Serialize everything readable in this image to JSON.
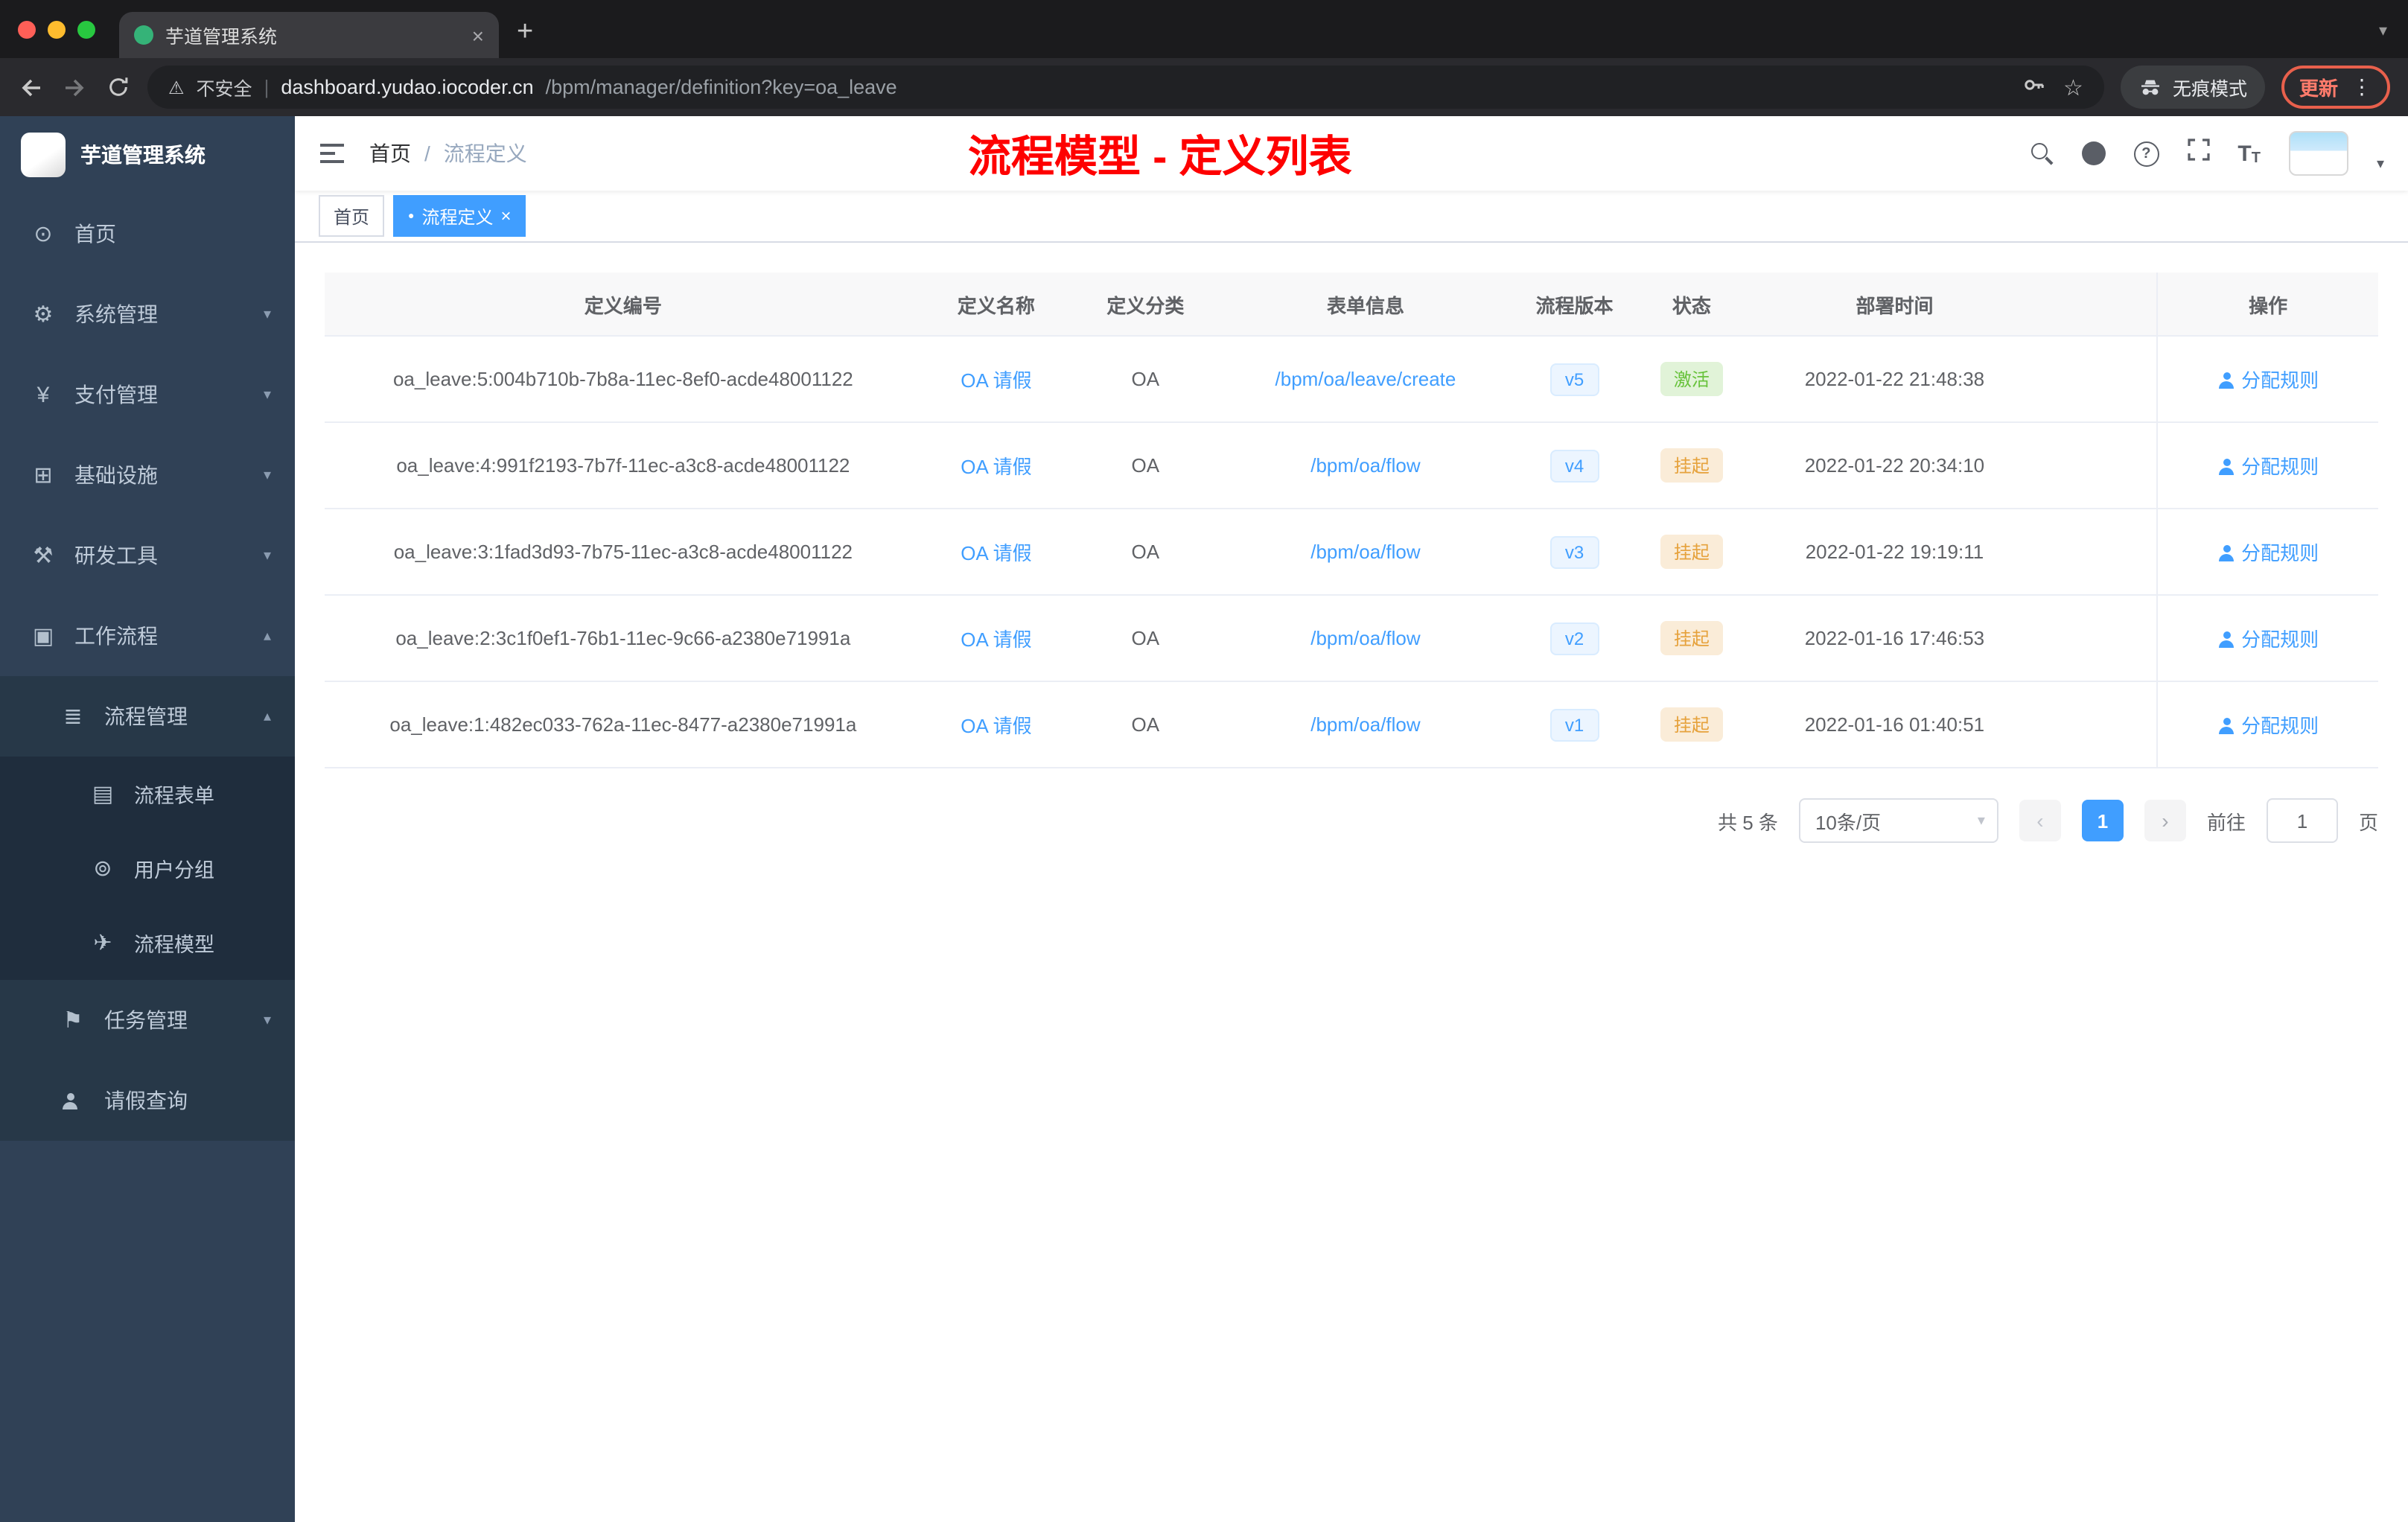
{
  "browser": {
    "tab_title": "芋道管理系统",
    "security": "不安全",
    "url_host": "dashboard.yudao.iocoder.cn",
    "url_rest": "/bpm/manager/definition?key=oa_leave",
    "incognito": "无痕模式",
    "update": "更新"
  },
  "icons": {
    "dashboard": "⊙",
    "gear": "⚙",
    "yen": "¥",
    "infra": "⊞",
    "tools": "⚒",
    "workflow": "▣",
    "list": "≣",
    "form": "▤",
    "group": "⊚",
    "send": "✈",
    "task": "⚑",
    "chevron_down": "▾",
    "chevron_up": "▴",
    "chevron_left": "‹",
    "chevron_right": "›",
    "close": "×",
    "dot": "●",
    "kebab": "⋮",
    "star": "☆",
    "warning": "⚠",
    "plus": "+",
    "divider": "|",
    "question": "?",
    "font_size": "T"
  },
  "sidebar": {
    "title": "芋道管理系统",
    "items": [
      {
        "label": "首页"
      },
      {
        "label": "系统管理"
      },
      {
        "label": "支付管理"
      },
      {
        "label": "基础设施"
      },
      {
        "label": "研发工具"
      },
      {
        "label": "工作流程"
      },
      {
        "label": "流程管理"
      },
      {
        "label": "流程表单"
      },
      {
        "label": "用户分组"
      },
      {
        "label": "流程模型"
      },
      {
        "label": "任务管理"
      },
      {
        "label": "请假查询"
      }
    ]
  },
  "header": {
    "breadcrumb_home": "首页",
    "breadcrumb_sep": "/",
    "breadcrumb_current": "流程定义",
    "annotation": "流程模型 - 定义列表"
  },
  "tags": {
    "home": "首页",
    "current": "流程定义"
  },
  "table": {
    "columns": {
      "id": "定义编号",
      "name": "定义名称",
      "category": "定义分类",
      "form": "表单信息",
      "version": "流程版本",
      "status": "状态",
      "time": "部署时间",
      "action": "操作"
    },
    "rows": [
      {
        "id": "oa_leave:5:004b710b-7b8a-11ec-8ef0-acde48001122",
        "name": "OA 请假",
        "category": "OA",
        "form": "/bpm/oa/leave/create",
        "version": "v5",
        "status": "激活",
        "status_type": "success",
        "time": "2022-01-22 21:48:38",
        "action": "分配规则"
      },
      {
        "id": "oa_leave:4:991f2193-7b7f-11ec-a3c8-acde48001122",
        "name": "OA 请假",
        "category": "OA",
        "form": "/bpm/oa/flow",
        "version": "v4",
        "status": "挂起",
        "status_type": "warning",
        "time": "2022-01-22 20:34:10",
        "action": "分配规则"
      },
      {
        "id": "oa_leave:3:1fad3d93-7b75-11ec-a3c8-acde48001122",
        "name": "OA 请假",
        "category": "OA",
        "form": "/bpm/oa/flow",
        "version": "v3",
        "status": "挂起",
        "status_type": "warning",
        "time": "2022-01-22 19:19:11",
        "action": "分配规则"
      },
      {
        "id": "oa_leave:2:3c1f0ef1-76b1-11ec-9c66-a2380e71991a",
        "name": "OA 请假",
        "category": "OA",
        "form": "/bpm/oa/flow",
        "version": "v2",
        "status": "挂起",
        "status_type": "warning",
        "time": "2022-01-16 17:46:53",
        "action": "分配规则"
      },
      {
        "id": "oa_leave:1:482ec033-762a-11ec-8477-a2380e71991a",
        "name": "OA 请假",
        "category": "OA",
        "form": "/bpm/oa/flow",
        "version": "v1",
        "status": "挂起",
        "status_type": "warning",
        "time": "2022-01-16 01:40:51",
        "action": "分配规则"
      }
    ]
  },
  "pagination": {
    "total": "共 5 条",
    "page_size": "10条/页",
    "page": "1",
    "goto": "前往",
    "goto_value": "1",
    "unit": "页"
  }
}
